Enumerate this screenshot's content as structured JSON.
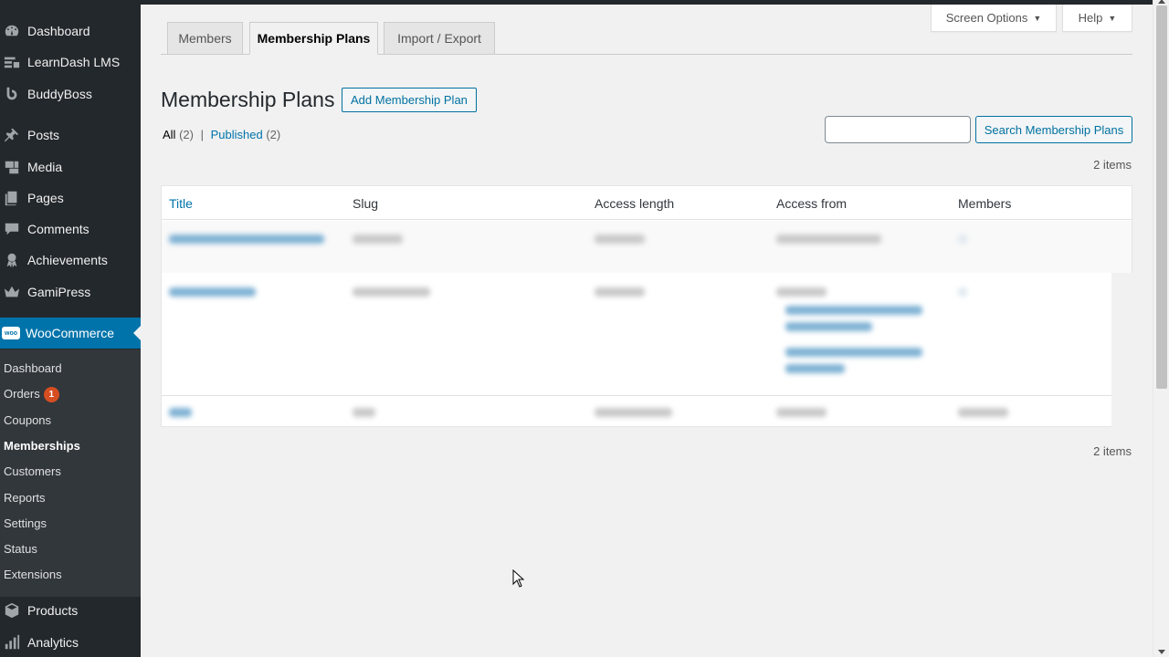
{
  "sidebar": {
    "items": [
      {
        "label": "Dashboard",
        "icon": "dashboard-icon"
      },
      {
        "label": "LearnDash LMS",
        "icon": "learndash-icon"
      },
      {
        "label": "BuddyBoss",
        "icon": "buddyboss-icon"
      },
      {
        "label": "Posts",
        "icon": "pin-icon"
      },
      {
        "label": "Media",
        "icon": "media-icon"
      },
      {
        "label": "Pages",
        "icon": "pages-icon"
      },
      {
        "label": "Comments",
        "icon": "comments-icon"
      },
      {
        "label": "Achievements",
        "icon": "achievements-icon"
      },
      {
        "label": "GamiPress",
        "icon": "crown-icon"
      },
      {
        "label": "WooCommerce",
        "icon": "woo-icon"
      },
      {
        "label": "Products",
        "icon": "products-icon"
      },
      {
        "label": "Analytics",
        "icon": "analytics-icon"
      }
    ],
    "woo_icon_text": "woo",
    "submenu": [
      {
        "label": "Dashboard"
      },
      {
        "label": "Orders",
        "badge": "1"
      },
      {
        "label": "Coupons"
      },
      {
        "label": "Memberships",
        "current": true
      },
      {
        "label": "Customers"
      },
      {
        "label": "Reports"
      },
      {
        "label": "Settings"
      },
      {
        "label": "Status"
      },
      {
        "label": "Extensions"
      }
    ]
  },
  "screen_options": {
    "label": "Screen Options",
    "caret": "▼"
  },
  "help": {
    "label": "Help",
    "caret": "▼"
  },
  "tabs": [
    {
      "label": "Members"
    },
    {
      "label": "Membership Plans",
      "active": true
    },
    {
      "label": "Import / Export"
    }
  ],
  "page": {
    "title": "Membership Plans",
    "add_button": "Add Membership Plan"
  },
  "filters": {
    "all_label": "All",
    "all_count": "(2)",
    "separator": "|",
    "published_label": "Published",
    "published_count": "(2)"
  },
  "search": {
    "placeholder": "",
    "button": "Search Membership Plans"
  },
  "items_top": "2 items",
  "items_bottom": "2 items",
  "table": {
    "columns": [
      "Title",
      "Slug",
      "Access length",
      "Access from",
      "Members"
    ]
  },
  "colors": {
    "sidebar_bg": "#23282d",
    "active_menu": "#0073aa",
    "link": "#0073aa",
    "badge": "#d54e21"
  }
}
